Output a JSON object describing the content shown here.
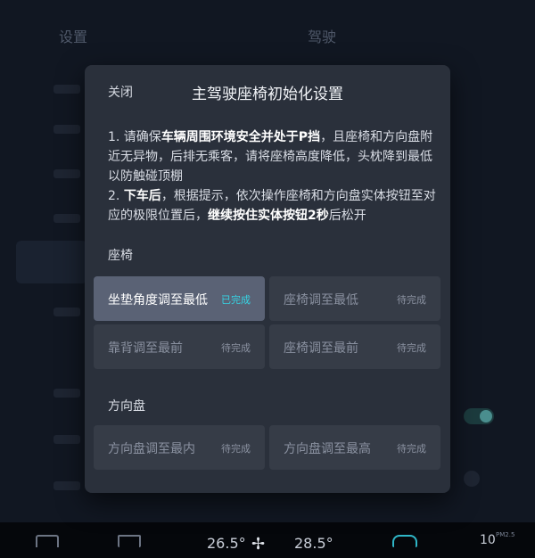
{
  "background": {
    "title_left": "设置",
    "title_center": "驾驶"
  },
  "modal": {
    "close_label": "关闭",
    "title": "主驾驶座椅初始化设置",
    "instructions": {
      "line1_prefix": "1. 请确保",
      "line1_bold": "车辆周围环境安全并处于P挡",
      "line1_suffix": "，且座椅和方向盘附近无异物，后排无乘客，请将座椅高度降低，头枕降到最低以防触碰顶棚",
      "line2_prefix": "2. ",
      "line2_bold1": "下车后",
      "line2_middle": "，根据提示，依次操作座椅和方向盘实体按钮至对应的极限位置后，",
      "line2_bold2": "继续按住实体按钮2秒",
      "line2_suffix": "后松开"
    },
    "seat_section": {
      "label": "座椅",
      "tiles": [
        {
          "label": "坐垫角度调至最低",
          "status": "已完成"
        },
        {
          "label": "座椅调至最低",
          "status": "待完成"
        },
        {
          "label": "靠背调至最前",
          "status": "待完成"
        },
        {
          "label": "座椅调至最前",
          "status": "待完成"
        }
      ]
    },
    "wheel_section": {
      "label": "方向盘",
      "tiles": [
        {
          "label": "方向盘调至最内",
          "status": "待完成"
        },
        {
          "label": "方向盘调至最高",
          "status": "待完成"
        }
      ]
    }
  },
  "bottom_bar": {
    "temp_left": "26.5°",
    "temp_right": "28.5°",
    "aqi_value": "10",
    "aqi_label": "PM2.5",
    "icons": [
      "front-defrost-icon",
      "rear-defrost-icon",
      "fan-icon",
      "recirculation-icon"
    ]
  },
  "colors": {
    "accent": "#36d4e4",
    "modal_bg": "#2a303b",
    "tile_bg": "#363c47",
    "tile_active_bg": "#5a6275"
  }
}
